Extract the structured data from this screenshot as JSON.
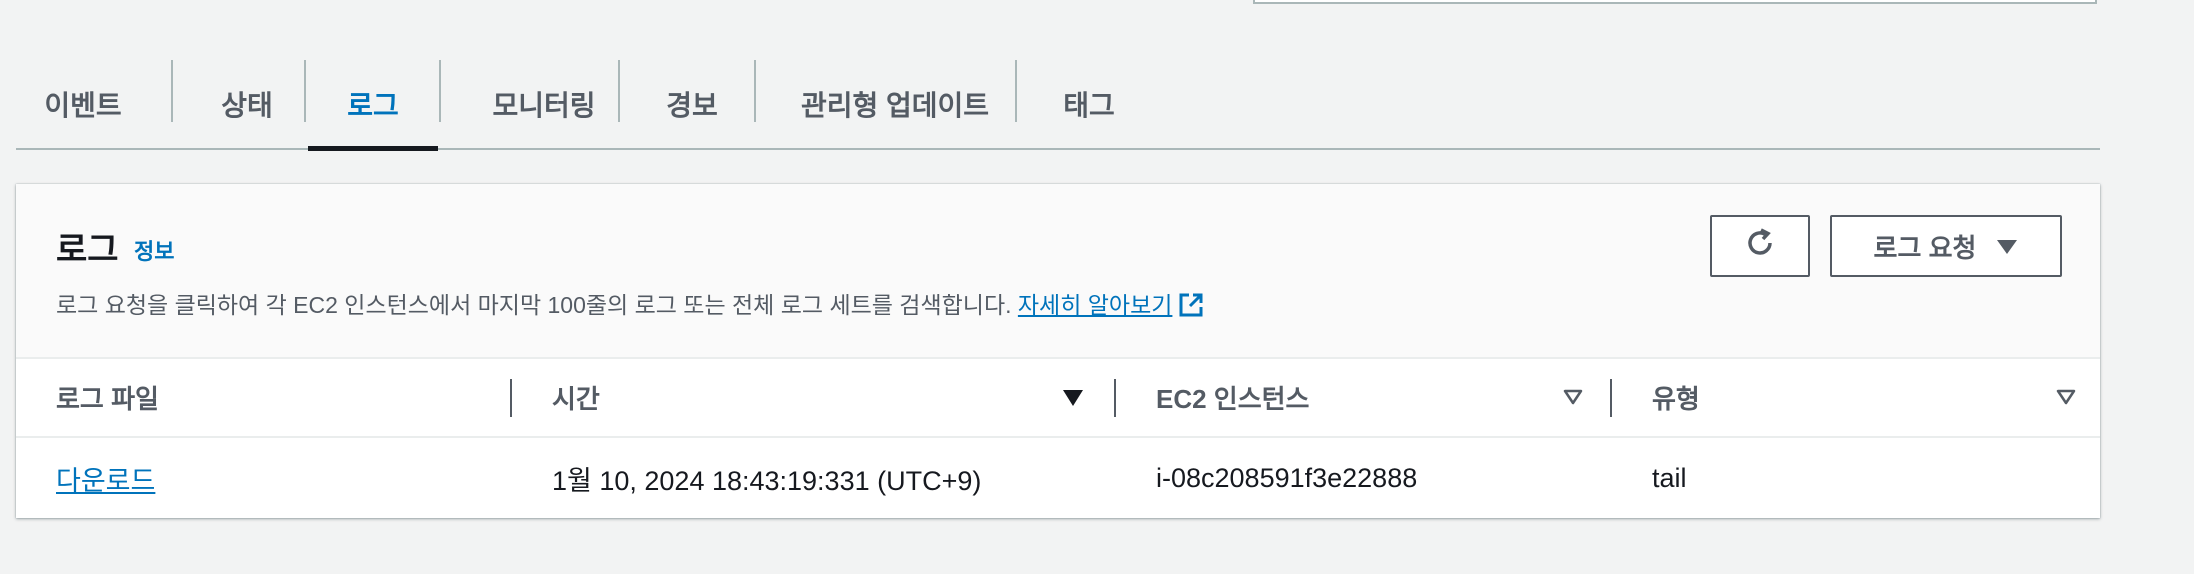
{
  "tabs": [
    {
      "label": "이벤트"
    },
    {
      "label": "상태"
    },
    {
      "label": "로그"
    },
    {
      "label": "모니터링"
    },
    {
      "label": "경보"
    },
    {
      "label": "관리형 업데이트"
    },
    {
      "label": "태그"
    }
  ],
  "active_tab": "로그",
  "logs_panel": {
    "title": "로그",
    "info_link": "정보",
    "description": "로그 요청을 클릭하여 각 EC2 인스턴스에서 마지막 100줄의 로그 또는 전체 로그 세트를 검색합니다.",
    "learn_more": "자세히 알아보기",
    "request_logs_button": "로그 요청",
    "refresh_icon": "refresh-icon",
    "external_link_icon": "external-link-icon"
  },
  "table": {
    "columns": [
      {
        "label": "로그 파일"
      },
      {
        "label": "시간"
      },
      {
        "label": "EC2 인스턴스"
      },
      {
        "label": "유형"
      }
    ],
    "rows": [
      {
        "log_file": "다운로드",
        "time": "1월 10, 2024 18:43:19:331 (UTC+9)",
        "instance": "i-08c208591f3e22888",
        "type": "tail"
      }
    ]
  },
  "colors": {
    "accent": "#0073bb",
    "text": "#16191f",
    "muted": "#545b64",
    "background": "#f2f3f3"
  }
}
